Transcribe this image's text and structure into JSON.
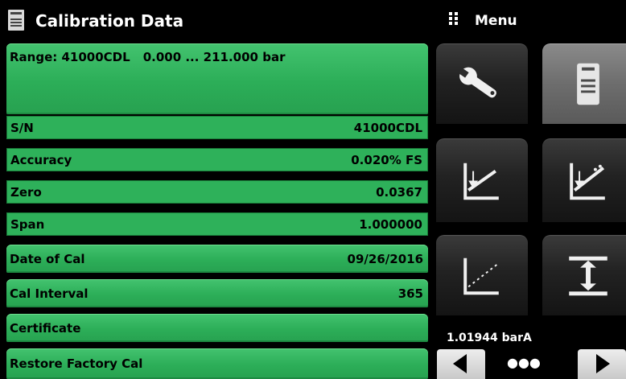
{
  "header": {
    "title": "Calibration Data",
    "menu_label": "Menu"
  },
  "rows": {
    "range": {
      "label": "Range: 41000CDL",
      "value": "0.000 ... 211.000 bar"
    },
    "sn": {
      "label": "S/N",
      "value": "41000CDL"
    },
    "accuracy": {
      "label": "Accuracy",
      "value": "0.020% FS"
    },
    "zero": {
      "label": "Zero",
      "value": "0.0367"
    },
    "span": {
      "label": "Span",
      "value": "1.000000"
    },
    "date_of_cal": {
      "label": "Date of Cal",
      "value": "09/26/2016"
    },
    "cal_interval": {
      "label": "Cal Interval",
      "value": "365"
    },
    "certificate": {
      "label": "Certificate"
    },
    "restore": {
      "label": "Restore Factory Cal"
    }
  },
  "menu_tiles": [
    {
      "icon": "wrench-icon"
    },
    {
      "icon": "document-icon"
    },
    {
      "icon": "calibration-chart-down-icon"
    },
    {
      "icon": "calibration-chart-up-icon"
    },
    {
      "icon": "linear-chart-icon"
    },
    {
      "icon": "span-arrow-icon"
    }
  ],
  "footer": {
    "reading": "1.01944 barA",
    "pager_dots": "●●●"
  },
  "colors": {
    "green": "#2eb15a",
    "background": "#000000",
    "tile_dark": "#222222",
    "tile_selected": "#6d6d6d"
  }
}
